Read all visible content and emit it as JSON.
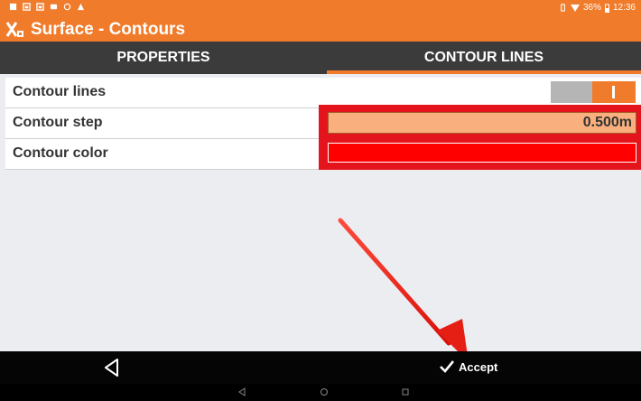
{
  "status_bar": {
    "battery": "36%",
    "time": "12:36",
    "icons": [
      "notification-icon",
      "gallery-icon",
      "gallery-icon",
      "play-icon",
      "sync-icon",
      "warning-icon",
      "vibrate-icon",
      "wifi-icon",
      "battery-icon"
    ]
  },
  "app": {
    "title": "Surface - Contours",
    "logo": "app-logo-icon"
  },
  "tabs": [
    {
      "label": "PROPERTIES",
      "active": false
    },
    {
      "label": "CONTOUR LINES",
      "active": true
    }
  ],
  "form": {
    "contour_lines_label": "Contour lines",
    "contour_lines_enabled": true,
    "contour_step_label": "Contour step",
    "contour_step_value": "0.500m",
    "contour_color_label": "Contour color",
    "contour_color_value": "#ff0000"
  },
  "bottom_bar": {
    "back_icon": "back-triangle-icon",
    "accept_label": "Accept",
    "accept_icon": "checkmark-icon"
  },
  "nav_bar": {
    "icons": [
      "nav-back-icon",
      "nav-home-icon",
      "nav-recents-icon"
    ]
  },
  "colors": {
    "accent": "#f07b2a",
    "tab_bar": "#3b3b3b",
    "highlight": "#e4141d",
    "field": "#f9b07e"
  }
}
